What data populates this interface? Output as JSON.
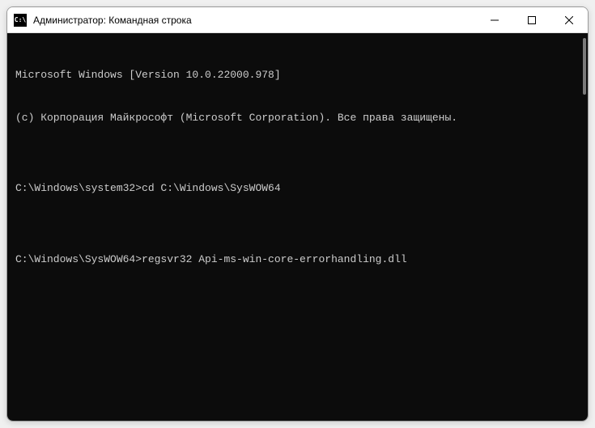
{
  "titlebar": {
    "icon_label": "C:\\",
    "title": "Администратор: Командная строка"
  },
  "terminal": {
    "lines": [
      "Microsoft Windows [Version 10.0.22000.978]",
      "(c) Корпорация Майкрософт (Microsoft Corporation). Все права защищены.",
      "",
      "C:\\Windows\\system32>cd C:\\Windows\\SysWOW64",
      "",
      "C:\\Windows\\SysWOW64>regsvr32 Api-ms-win-core-errorhandling.dll"
    ]
  }
}
